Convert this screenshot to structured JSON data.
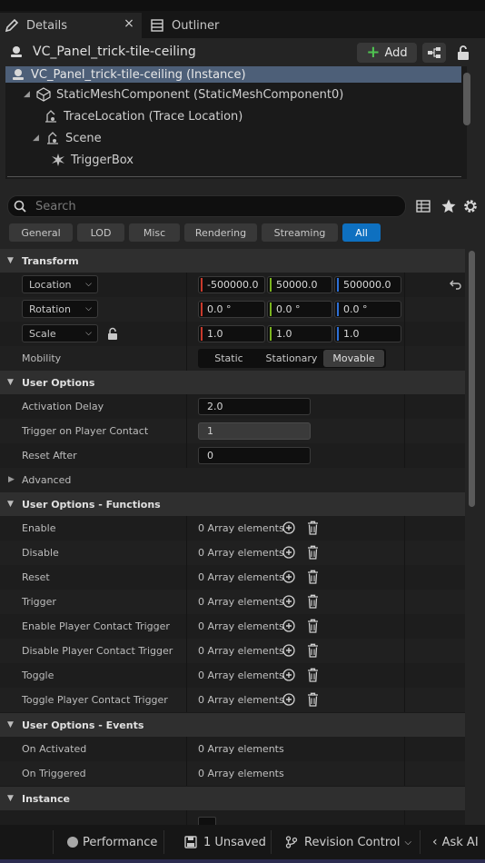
{
  "tabs": {
    "details": "Details",
    "outliner": "Outliner",
    "close": "×"
  },
  "actor": {
    "name": "VC_Panel_trick-tile-ceiling",
    "add_label": "Add"
  },
  "tree": {
    "items": [
      {
        "label": "VC_Panel_trick-tile-ceiling (Instance)"
      },
      {
        "label": "StaticMeshComponent (StaticMeshComponent0)"
      },
      {
        "label": "TraceLocation (Trace Location)"
      },
      {
        "label": "Scene"
      },
      {
        "label": "TriggerBox"
      }
    ]
  },
  "search": {
    "placeholder": "Search"
  },
  "filters": [
    "General",
    "LOD",
    "Misc",
    "Rendering",
    "Streaming",
    "All"
  ],
  "active_filter": "All",
  "transform": {
    "title": "Transform",
    "location": {
      "label": "Location",
      "x": "-500000.0",
      "y": "50000.0",
      "z": "500000.0"
    },
    "rotation": {
      "label": "Rotation",
      "x": "0.0 °",
      "y": "0.0 °",
      "z": "0.0 °"
    },
    "scale": {
      "label": "Scale",
      "x": "1.0",
      "y": "1.0",
      "z": "1.0"
    },
    "mobility": {
      "label": "Mobility",
      "options": [
        "Static",
        "Stationary",
        "Movable"
      ],
      "selected": "Movable"
    }
  },
  "user_options": {
    "title": "User Options",
    "activation_delay": {
      "label": "Activation Delay",
      "value": "2.0"
    },
    "trigger_on_contact": {
      "label": "Trigger on Player Contact",
      "value": "1"
    },
    "reset_after": {
      "label": "Reset After",
      "value": "0"
    },
    "advanced": "Advanced"
  },
  "functions": {
    "title": "User Options - Functions",
    "items": [
      {
        "label": "Enable",
        "value": "0 Array elements"
      },
      {
        "label": "Disable",
        "value": "0 Array elements"
      },
      {
        "label": "Reset",
        "value": "0 Array elements"
      },
      {
        "label": "Trigger",
        "value": "0 Array elements"
      },
      {
        "label": "Enable Player Contact Trigger",
        "value": "0 Array elements"
      },
      {
        "label": "Disable Player Contact Trigger",
        "value": "0 Array elements"
      },
      {
        "label": "Toggle",
        "value": "0 Array elements"
      },
      {
        "label": "Toggle Player Contact Trigger",
        "value": "0 Array elements"
      }
    ]
  },
  "events": {
    "title": "User Options - Events",
    "items": [
      {
        "label": "On Activated",
        "value": "0 Array elements"
      },
      {
        "label": "On Triggered",
        "value": "0 Array elements"
      }
    ]
  },
  "instance": {
    "title": "Instance"
  },
  "statusbar": {
    "performance": "Performance",
    "unsaved": "1 Unsaved",
    "revision": "Revision Control",
    "ask_ai": "Ask AI"
  },
  "colors": {
    "accent": "#0e70c0",
    "selection": "#4d5f78",
    "axis_x": "#c93a2c",
    "axis_y": "#7bb41f",
    "axis_z": "#2d6fd6",
    "add_plus": "#4fc251"
  },
  "icons": [
    "pencil-icon",
    "outliner-icon",
    "close-icon",
    "actor-icon",
    "plus-icon",
    "blueprint-icon",
    "lock-icon",
    "mesh-icon",
    "scene-icon",
    "trigger-icon",
    "search-icon",
    "grid-icon",
    "star-icon",
    "gear-icon",
    "reset-arrow-icon",
    "unlock-icon",
    "add-element-icon",
    "trash-icon",
    "performance-icon",
    "save-icon",
    "revision-icon",
    "chevron-left-icon"
  ]
}
